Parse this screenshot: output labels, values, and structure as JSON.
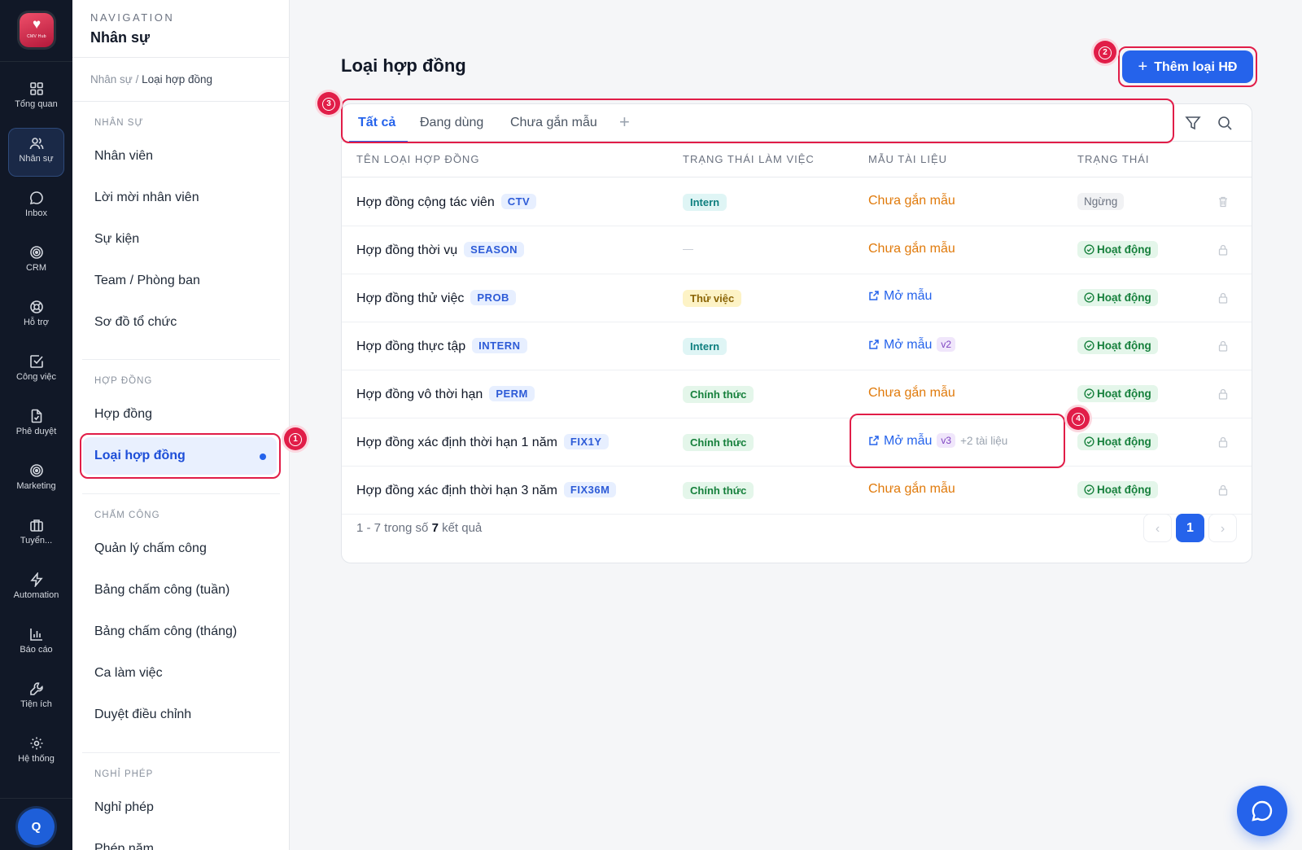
{
  "rail": {
    "logo_text": "CMV Hub",
    "items": [
      {
        "label": "Tổng quan",
        "icon": "grid-icon"
      },
      {
        "label": "Nhân sự",
        "icon": "users-icon"
      },
      {
        "label": "Inbox",
        "icon": "chat-icon"
      },
      {
        "label": "CRM",
        "icon": "target-icon"
      },
      {
        "label": "Hỗ trợ",
        "icon": "lifebuoy-icon"
      },
      {
        "label": "Công việc",
        "icon": "checkbox-icon"
      },
      {
        "label": "Phê duyệt",
        "icon": "file-check-icon"
      },
      {
        "label": "Marketing",
        "icon": "target-icon"
      },
      {
        "label": "Tuyển...",
        "icon": "briefcase-icon"
      },
      {
        "label": "Automation",
        "icon": "bolt-icon"
      },
      {
        "label": "Báo cáo",
        "icon": "bar-chart-icon"
      },
      {
        "label": "Tiện ích",
        "icon": "wrench-icon"
      },
      {
        "label": "Hệ thống",
        "icon": "gear-icon"
      }
    ],
    "avatar": "Q"
  },
  "subnav": {
    "caption": "NAVIGATION",
    "title": "Nhân sự",
    "breadcrumb": {
      "parent": "Nhân sự",
      "sep": " / ",
      "current": "Loại hợp đồng"
    },
    "groups": [
      {
        "label": "NHÂN SỰ",
        "items": [
          "Nhân viên",
          "Lời mời nhân viên",
          "Sự kiện",
          "Team / Phòng ban",
          "Sơ đồ tổ chức"
        ]
      },
      {
        "label": "HỢP ĐỒNG",
        "items": [
          "Hợp đồng",
          "Loại hợp đồng"
        ]
      },
      {
        "label": "CHẤM CÔNG",
        "items": [
          "Quản lý chấm công",
          "Bảng chấm công (tuần)",
          "Bảng chấm công (tháng)",
          "Ca làm việc",
          "Duyệt điều chỉnh"
        ]
      },
      {
        "label": "NGHỈ PHÉP",
        "items": [
          "Nghỉ phép",
          "Phép năm"
        ]
      }
    ]
  },
  "markers": [
    "1",
    "2",
    "3",
    "4"
  ],
  "main": {
    "title": "Loại hợp đồng",
    "add_button": "Thêm loại HĐ",
    "tabs": [
      "Tất cả",
      "Đang dùng",
      "Chưa gắn mẫu"
    ],
    "tab_add": "+",
    "columns": [
      "TÊN LOẠI HỢP ĐỒNG",
      "TRẠNG THÁI LÀM VIỆC",
      "MẪU TÀI LIỆU",
      "TRẠNG THÁI"
    ],
    "rows": [
      {
        "name": "Hợp đồng cộng tác viên",
        "code": "CTV",
        "work_status": "Intern",
        "template": "Chưa gắn mẫu",
        "status": "Ngừng"
      },
      {
        "name": "Hợp đồng thời vụ",
        "code": "SEASON",
        "work_status": "—",
        "template": "Chưa gắn mẫu",
        "status": "Hoạt động"
      },
      {
        "name": "Hợp đồng thử việc",
        "code": "PROB",
        "work_status": "Thử việc",
        "template": "Mở mẫu",
        "status": "Hoạt động"
      },
      {
        "name": "Hợp đồng thực tập",
        "code": "INTERN",
        "work_status": "Intern",
        "template": "Mở mẫu",
        "version": "v2",
        "status": "Hoạt động"
      },
      {
        "name": "Hợp đồng vô thời hạn",
        "code": "PERM",
        "work_status": "Chính thức",
        "template": "Chưa gắn mẫu",
        "status": "Hoạt động"
      },
      {
        "name": "Hợp đồng xác định thời hạn 1 năm",
        "code": "FIX1Y",
        "work_status": "Chính thức",
        "template": "Mở mẫu",
        "version": "v3",
        "extra": "+2 tài liệu",
        "status": "Hoạt động"
      },
      {
        "name": "Hợp đồng xác định thời hạn 3 năm",
        "code": "FIX36M",
        "work_status": "Chính thức",
        "template": "Chưa gắn mẫu",
        "status": "Hoạt động"
      }
    ],
    "footer": {
      "range": "1 - 7 trong số ",
      "total": "7",
      "suffix": " kết quả"
    },
    "pagination": {
      "prev": "‹",
      "current": "1",
      "next": "›"
    }
  },
  "colors": {
    "accent": "#2563eb",
    "highlight": "#e11d48",
    "rail_bg": "#111827"
  }
}
